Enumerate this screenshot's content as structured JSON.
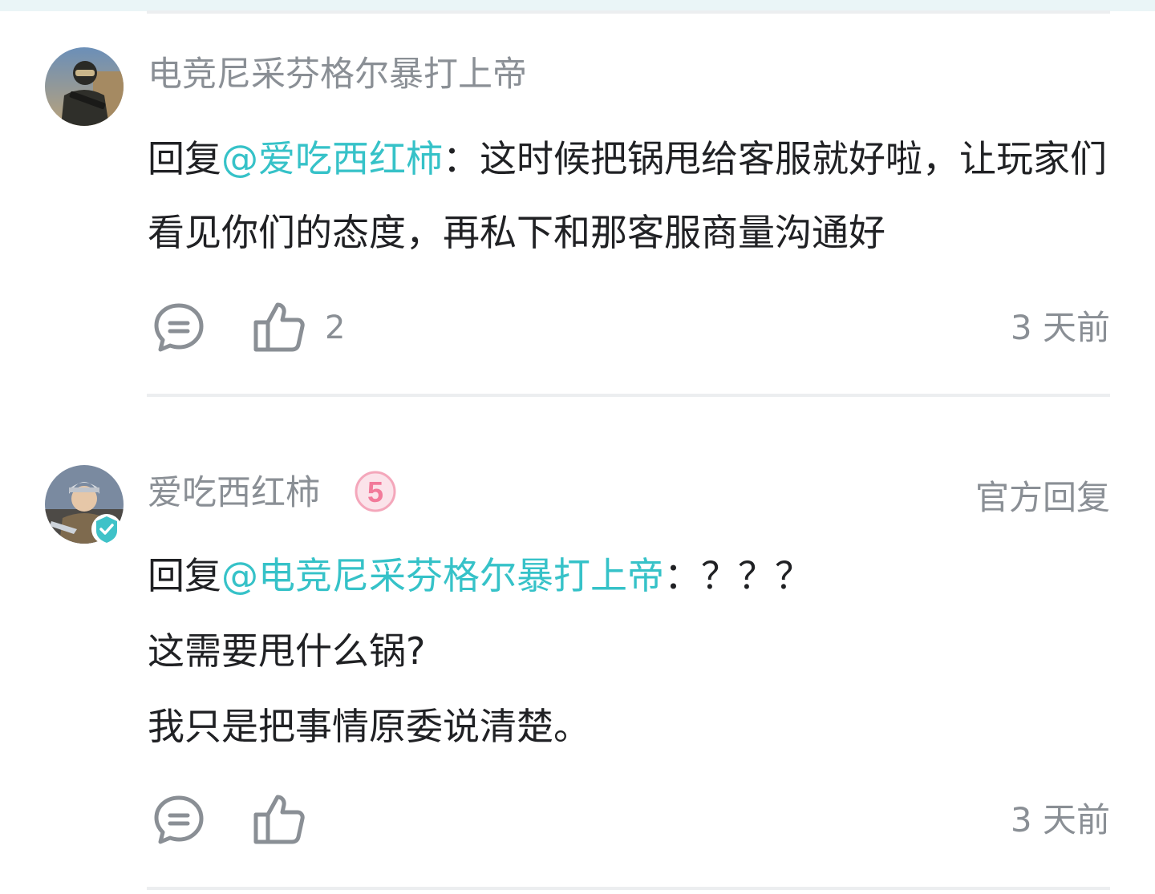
{
  "comments": [
    {
      "username": "电竞尼采芬格尔暴打上帝",
      "reply_prefix": "回复",
      "mention": "@爱吃西红柿",
      "text": "：这时候把锅甩给客服就好啦，让玩家们看见你们的态度，再私下和那客服商量沟通好",
      "like_count": "2",
      "time": "3 天前",
      "icons": {
        "reply": "comment-icon",
        "like": "thumbs-up-icon"
      }
    },
    {
      "username": "爱吃西红柿",
      "level_badge": "5",
      "official_label": "官方回复",
      "reply_prefix": "回复",
      "mention": "@电竞尼采芬格尔暴打上帝",
      "text": "：？？？",
      "lines": [
        "这需要甩什么锅?",
        "我只是把事情原委说清楚。"
      ],
      "time": "3 天前",
      "icons": {
        "reply": "comment-icon",
        "like": "thumbs-up-icon",
        "verified": "verified-check-icon"
      }
    }
  ],
  "colors": {
    "mention": "#36c2c8",
    "muted_text": "#8a8f95",
    "body_text": "#202124",
    "badge_pink": "#f27a9a",
    "verified": "#3fc2c8"
  }
}
